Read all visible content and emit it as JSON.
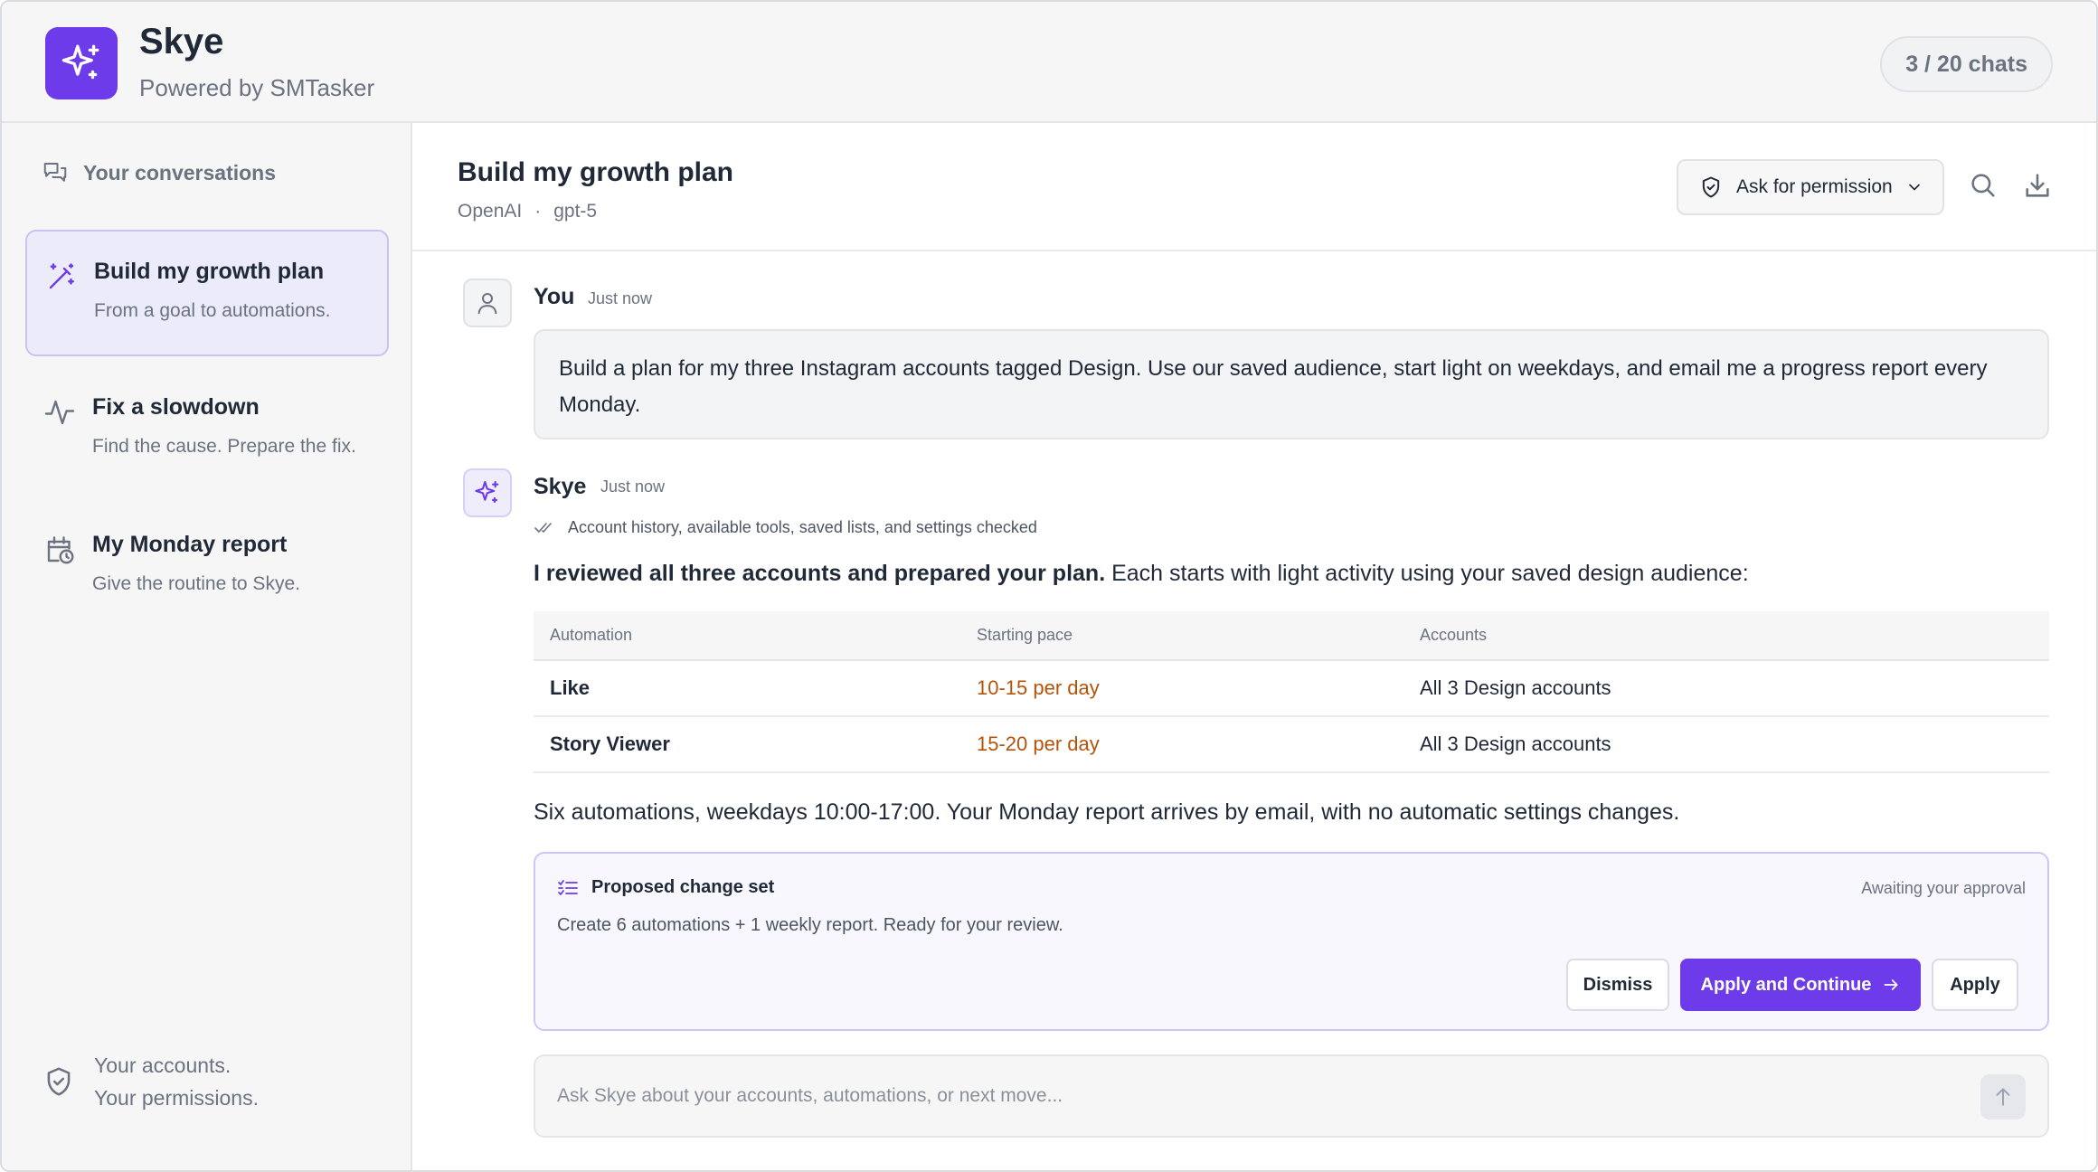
{
  "app": {
    "name": "Skye",
    "powered_by": "Powered by SMTasker",
    "chat_count": "3 / 20 chats",
    "brand_color": "#6d3bea"
  },
  "sidebar": {
    "heading": "Your conversations",
    "items": [
      {
        "title": "Build my growth plan",
        "subtitle": "From a goal to automations.",
        "icon": "magic-wand-icon",
        "active": true
      },
      {
        "title": "Fix a slowdown",
        "subtitle": "Find the cause. Prepare the fix.",
        "icon": "activity-pulse-icon",
        "active": false
      },
      {
        "title": "My Monday report",
        "subtitle": "Give the routine to Skye.",
        "icon": "calendar-clock-icon",
        "active": false
      }
    ],
    "footer": {
      "line1": "Your accounts.",
      "line2": "Your permissions.",
      "icon": "shield-check-icon"
    }
  },
  "chat": {
    "title": "Build my growth plan",
    "provider": "OpenAI",
    "separator": "·",
    "model": "gpt-5",
    "permission_label": "Ask for permission"
  },
  "messages": {
    "user": {
      "sender": "You",
      "time": "Just now",
      "text": "Build a plan for my three Instagram accounts tagged Design. Use our saved audience, start light on weekdays, and email me a progress report every Monday."
    },
    "assistant": {
      "sender": "Skye",
      "time": "Just now",
      "checked": "Account history, available tools, saved lists, and settings checked",
      "intro_bold": "I reviewed all three accounts and prepared your plan.",
      "intro_rest": " Each starts with light activity using your saved design audience:",
      "table": {
        "headers": [
          "Automation",
          "Starting pace",
          "Accounts"
        ],
        "rows": [
          {
            "automation": "Like",
            "pace": "10-15 per day",
            "accounts": "All 3 Design accounts"
          },
          {
            "automation": "Story Viewer",
            "pace": "15-20 per day",
            "accounts": "All 3 Design accounts"
          }
        ]
      },
      "summary": "Six automations, weekdays 10:00-17:00. Your Monday report arrives by email, with no automatic settings changes."
    }
  },
  "change_set": {
    "title": "Proposed change set",
    "status": "Awaiting your approval",
    "description": "Create 6 automations + 1 weekly report. Ready for your review.",
    "dismiss_label": "Dismiss",
    "apply_continue_label": "Apply and Continue",
    "apply_label": "Apply"
  },
  "composer": {
    "placeholder": "Ask Skye about your accounts, automations, or next move...",
    "value": ""
  }
}
